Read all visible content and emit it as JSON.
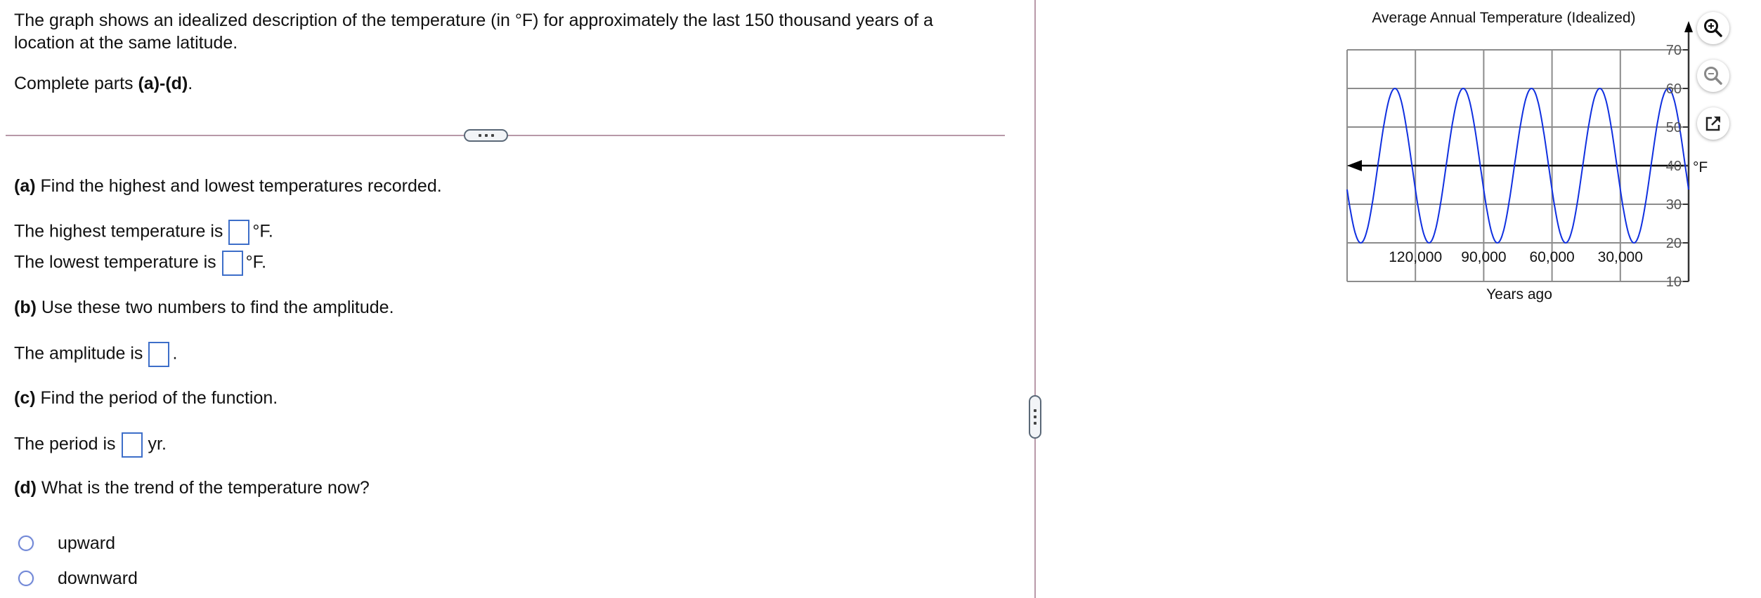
{
  "question": {
    "intro_line1": "The graph shows an idealized description of the temperature (in °F) for approximately the last 150 thousand years of a",
    "intro_line2": "location at the same latitude.",
    "instruction_prefix": "Complete parts ",
    "instruction_bold": "(a)-(d)",
    "instruction_suffix": "."
  },
  "parts": {
    "a": {
      "label": "(a)",
      "prompt": " Find the highest and lowest temperatures recorded.",
      "highest_prefix": "The highest temperature is",
      "highest_value": "",
      "highest_unit": "°F.",
      "lowest_prefix": "The lowest temperature is",
      "lowest_value": "",
      "lowest_unit": "°F."
    },
    "b": {
      "label": "(b)",
      "prompt": " Use these two numbers to find the amplitude.",
      "answer_prefix": "The amplitude is",
      "answer_value": "",
      "answer_suffix": "."
    },
    "c": {
      "label": "(c)",
      "prompt": " Find the period of the function.",
      "answer_prefix": "The period is",
      "answer_value": "",
      "answer_suffix": "yr."
    },
    "d": {
      "label": "(d)",
      "prompt": " What is the trend of the temperature now?",
      "options": [
        "upward",
        "downward"
      ],
      "selected": null
    }
  },
  "handles": {
    "horizontal_dots": "...",
    "vertical_dots": "..."
  },
  "toolbar": {
    "zoom_in": "zoom-in",
    "zoom_out": "zoom-out",
    "open_external": "open-in-new-window"
  },
  "colors": {
    "curve": "#1030e0",
    "grid": "#8c8c8c",
    "axis": "#000000",
    "answer_box": "#3d6ec9",
    "divider": "#b899a8"
  },
  "chart_data": {
    "type": "line",
    "title": "Average Annual Temperature (Idealized)",
    "xlabel": "Years ago",
    "ylabel": "°F",
    "xlim": [
      150000,
      0
    ],
    "ylim": [
      10,
      70
    ],
    "x_ticks": [
      120000,
      90000,
      60000,
      30000
    ],
    "x_tick_labels": [
      "120,000",
      "90,000",
      "60,000",
      "30,000"
    ],
    "y_ticks": [
      10,
      20,
      30,
      40,
      50,
      60,
      70
    ],
    "y_tick_labels": [
      "10",
      "20",
      "30",
      "40",
      "50",
      "60",
      "70"
    ],
    "grid": true,
    "x_axis_at_y": 40,
    "series": [
      {
        "name": "Temperature",
        "function": "40 + 20*cos(2*pi*(x - 129000)/30000)",
        "midline": 40,
        "amplitude": 20,
        "period": 30000,
        "peak_at_years_ago": [
          129000,
          99000,
          69000,
          39000,
          9000
        ],
        "trough_at_years_ago": [
          144000,
          114000,
          84000,
          54000,
          24000
        ],
        "max": 60,
        "min": 20,
        "value_at_150000": 34,
        "value_at_0": 34
      }
    ]
  }
}
